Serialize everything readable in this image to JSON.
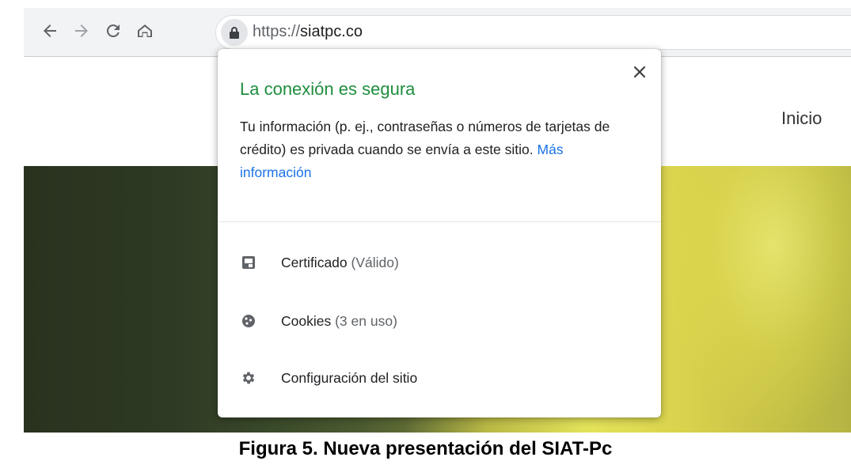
{
  "browser": {
    "url_scheme": "https://",
    "url_host": "siatpc.co"
  },
  "page": {
    "nav_link": "Inicio"
  },
  "popup": {
    "title": "La conexión es segura",
    "description": "Tu información (p. ej., contraseñas o números de tarjetas de crédito) es privada cuando se envía a este sitio.",
    "more_info_link": "Más información",
    "items": [
      {
        "label": "Certificado",
        "detail": "(Válido)",
        "icon": "certificate-icon"
      },
      {
        "label": "Cookies",
        "detail": "(3 en uso)",
        "icon": "cookie-icon"
      },
      {
        "label": "Configuración del sitio",
        "detail": "",
        "icon": "gear-icon"
      }
    ]
  },
  "caption": "Figura 5. Nueva presentación del SIAT-Pc",
  "colors": {
    "title_green": "#1e8e3e",
    "link_blue": "#1a73e8",
    "toolbar_bg": "#f1f3f4"
  }
}
